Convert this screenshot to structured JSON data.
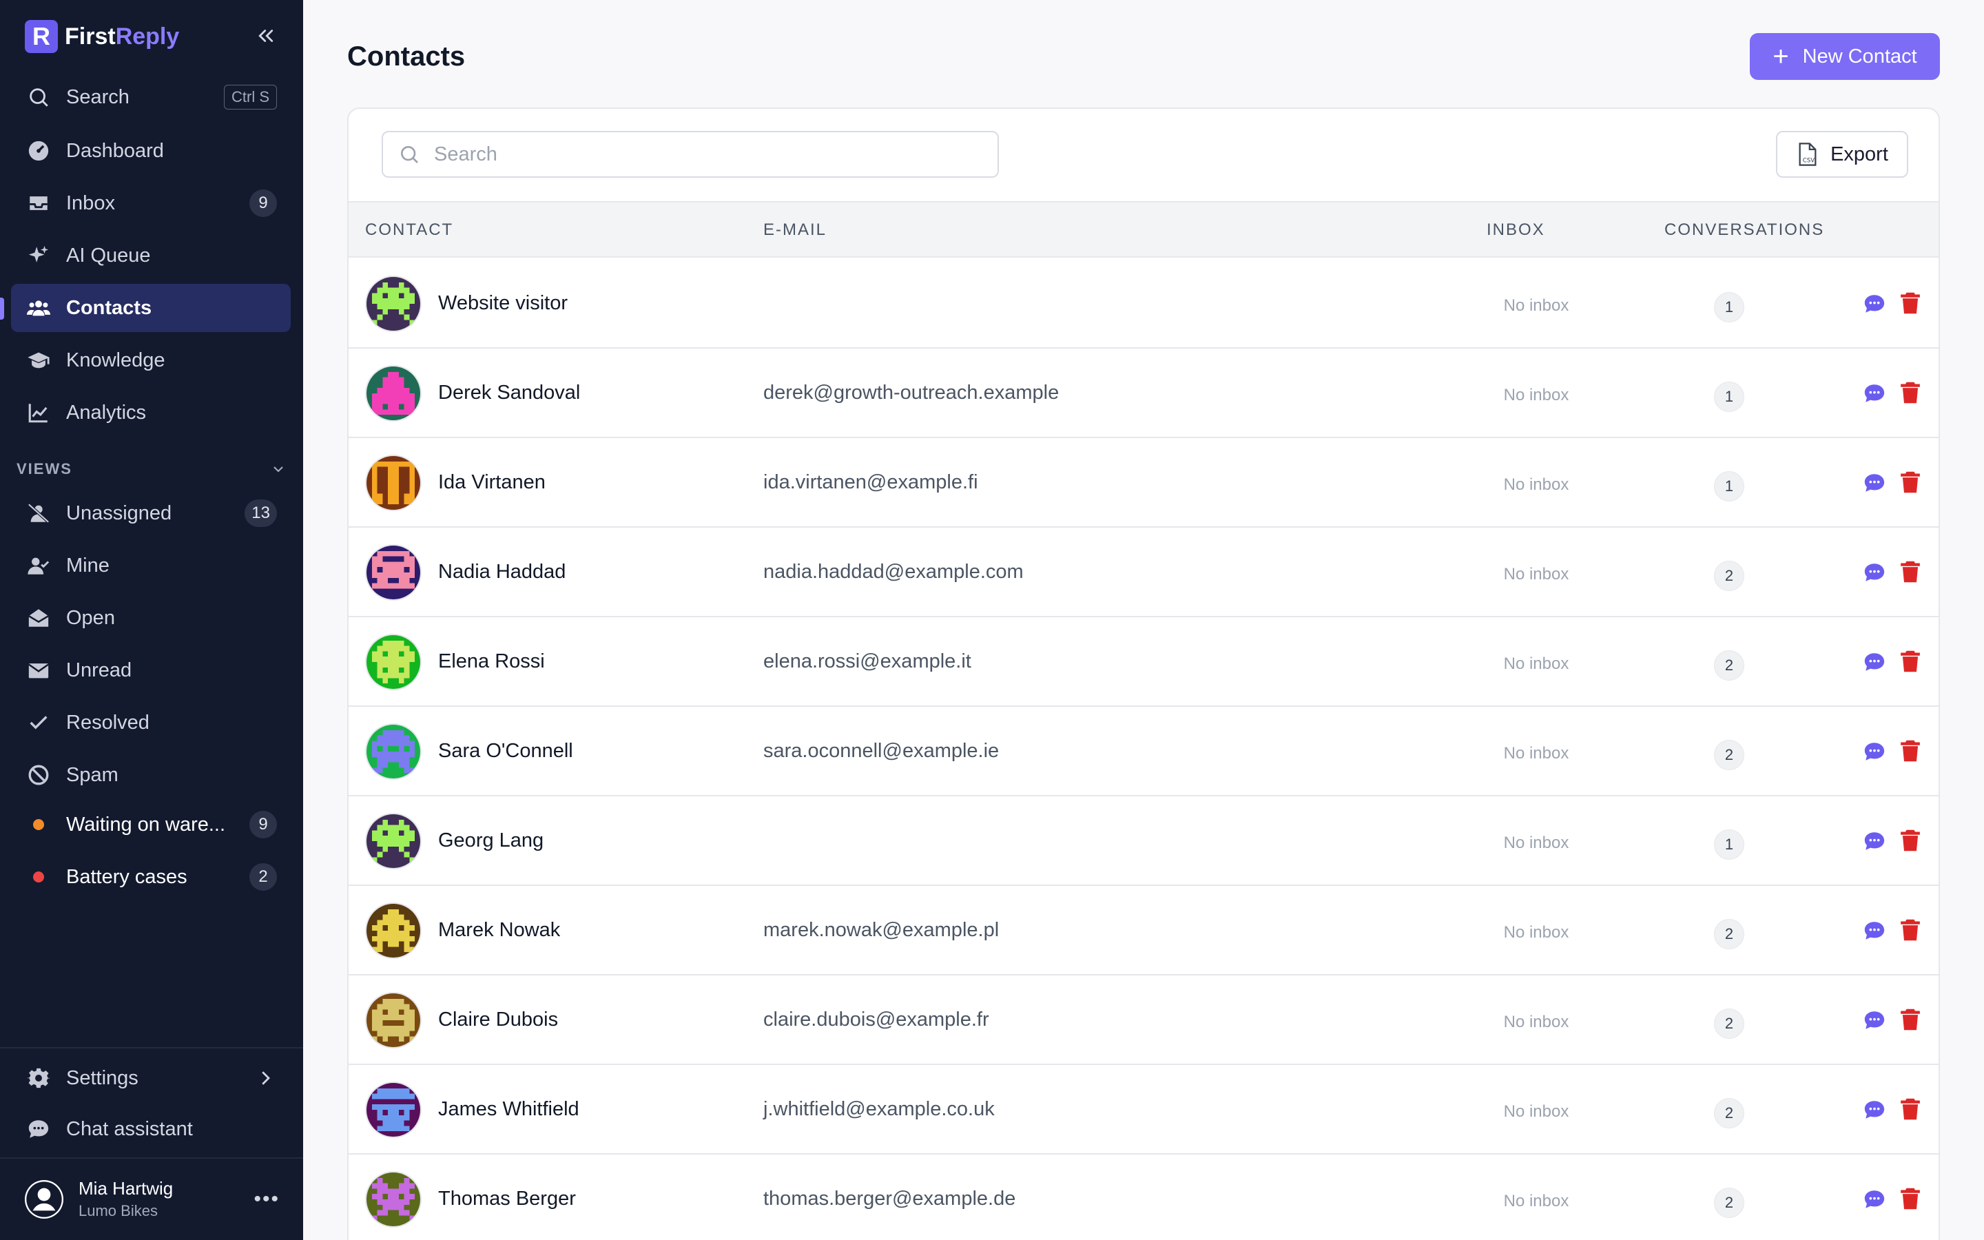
{
  "brand": {
    "first": "First",
    "second": "Reply",
    "logo_letter": "R"
  },
  "sidebar": {
    "search": {
      "label": "Search",
      "shortcut": "Ctrl S"
    },
    "items": [
      {
        "id": "dashboard",
        "label": "Dashboard",
        "icon": "dashboard-icon"
      },
      {
        "id": "inbox",
        "label": "Inbox",
        "badge": "9",
        "icon": "inbox-icon"
      },
      {
        "id": "ai-queue",
        "label": "AI Queue",
        "icon": "sparkles-icon"
      },
      {
        "id": "contacts",
        "label": "Contacts",
        "icon": "users-icon",
        "active": true
      },
      {
        "id": "knowledge",
        "label": "Knowledge",
        "icon": "graduation-cap-icon"
      },
      {
        "id": "analytics",
        "label": "Analytics",
        "icon": "chart-icon"
      }
    ],
    "views_label": "VIEWS",
    "views": [
      {
        "id": "unassigned",
        "label": "Unassigned",
        "badge": "13",
        "icon": "user-slash-icon"
      },
      {
        "id": "mine",
        "label": "Mine",
        "icon": "user-check-icon"
      },
      {
        "id": "open",
        "label": "Open",
        "icon": "envelope-open-icon"
      },
      {
        "id": "unread",
        "label": "Unread",
        "icon": "envelope-icon"
      },
      {
        "id": "resolved",
        "label": "Resolved",
        "icon": "check-icon"
      },
      {
        "id": "spam",
        "label": "Spam",
        "icon": "ban-icon"
      },
      {
        "id": "waiting",
        "label": "Waiting on ware...",
        "badge": "9",
        "color": "#f28c28"
      },
      {
        "id": "battery",
        "label": "Battery cases",
        "badge": "2",
        "color": "#ef4444"
      }
    ],
    "settings_label": "Settings",
    "chat_label": "Chat assistant",
    "user": {
      "name": "Mia Hartwig",
      "org": "Lumo Bikes"
    }
  },
  "page": {
    "title": "Contacts",
    "new_contact_label": "New Contact",
    "search_placeholder": "Search",
    "export_label": "Export",
    "columns": {
      "contact": "CONTACT",
      "email": "E-MAIL",
      "inbox": "INBOX",
      "conversations": "CONVERSATIONS"
    }
  },
  "contacts": [
    {
      "name": "Website visitor",
      "email": "",
      "inbox": "No inbox",
      "conversations": "1",
      "avatar_bg": "#3f2e56",
      "avatar_fg": "#9ef05a"
    },
    {
      "name": "Derek Sandoval",
      "email": "derek@growth-outreach.example",
      "inbox": "No inbox",
      "conversations": "1",
      "avatar_bg": "#1f6b55",
      "avatar_fg": "#f23fb7"
    },
    {
      "name": "Ida Virtanen",
      "email": "ida.virtanen@example.fi",
      "inbox": "No inbox",
      "conversations": "1",
      "avatar_bg": "#7a3312",
      "avatar_fg": "#f5a623"
    },
    {
      "name": "Nadia Haddad",
      "email": "nadia.haddad@example.com",
      "inbox": "No inbox",
      "conversations": "2",
      "avatar_bg": "#2d1b6b",
      "avatar_fg": "#f28ba8"
    },
    {
      "name": "Elena Rossi",
      "email": "elena.rossi@example.it",
      "inbox": "No inbox",
      "conversations": "2",
      "avatar_bg": "#12b51f",
      "avatar_fg": "#c6e85c"
    },
    {
      "name": "Sara O'Connell",
      "email": "sara.oconnell@example.ie",
      "inbox": "No inbox",
      "conversations": "2",
      "avatar_bg": "#17b34a",
      "avatar_fg": "#7a7cf0"
    },
    {
      "name": "Georg Lang",
      "email": "",
      "inbox": "No inbox",
      "conversations": "1",
      "avatar_bg": "#3f2e56",
      "avatar_fg": "#9ef05a"
    },
    {
      "name": "Marek Nowak",
      "email": "marek.nowak@example.pl",
      "inbox": "No inbox",
      "conversations": "2",
      "avatar_bg": "#5a3a10",
      "avatar_fg": "#e8d04a"
    },
    {
      "name": "Claire Dubois",
      "email": "claire.dubois@example.fr",
      "inbox": "No inbox",
      "conversations": "2",
      "avatar_bg": "#7a4a12",
      "avatar_fg": "#d8c46a"
    },
    {
      "name": "James Whitfield",
      "email": "j.whitfield@example.co.uk",
      "inbox": "No inbox",
      "conversations": "2",
      "avatar_bg": "#5a0f5a",
      "avatar_fg": "#6a9af0"
    },
    {
      "name": "Thomas Berger",
      "email": "thomas.berger@example.de",
      "inbox": "No inbox",
      "conversations": "2",
      "avatar_bg": "#5a6a1a",
      "avatar_fg": "#c66ae0"
    }
  ],
  "colors": {
    "accent": "#7c6cf6",
    "sidebar_bg": "#131a2e",
    "delete": "#dc2626",
    "chat": "#6b5cf0"
  }
}
